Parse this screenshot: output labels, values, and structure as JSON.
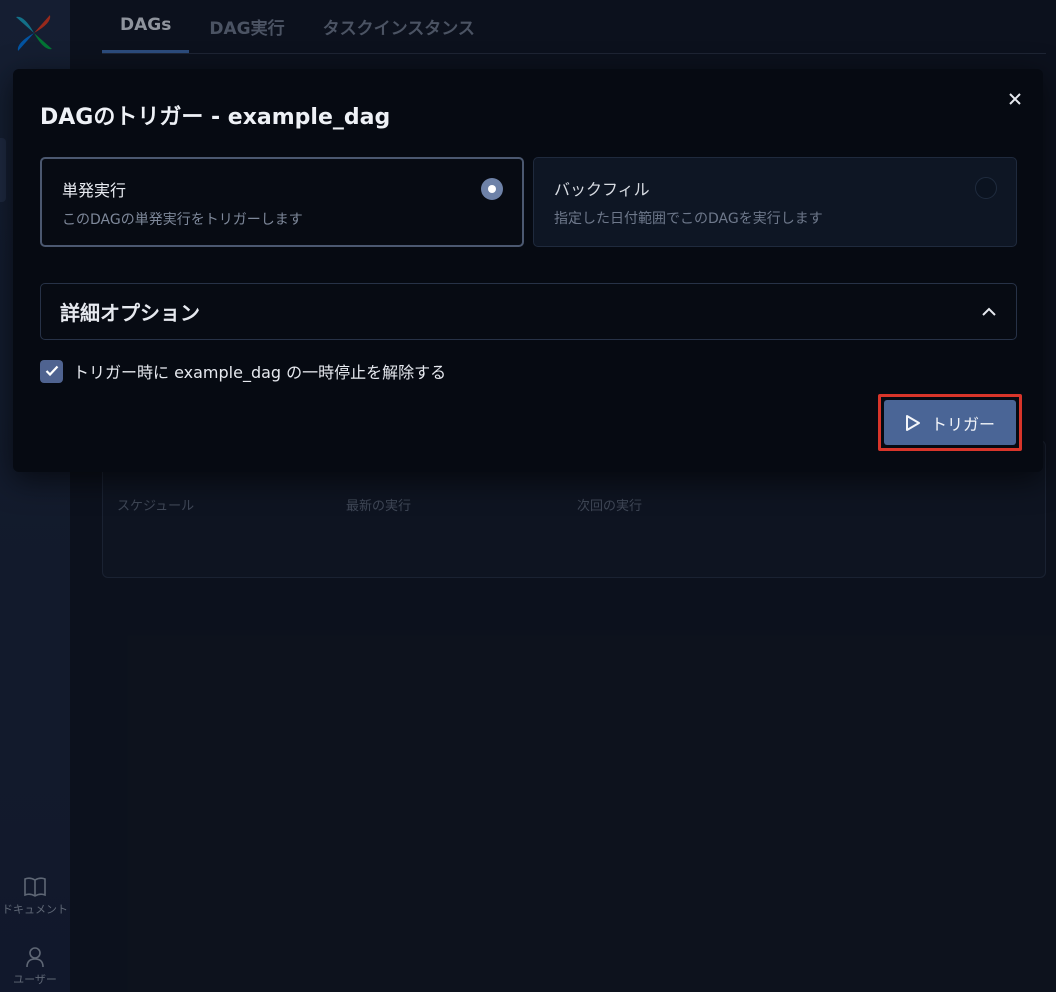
{
  "tabs": [
    {
      "label": "DAGs",
      "active": true
    },
    {
      "label": "DAG実行",
      "active": false
    },
    {
      "label": "タスクインスタンス",
      "active": false
    }
  ],
  "sidebar": {
    "docs_label": "ドキュメント",
    "user_label": "ユーザー"
  },
  "background_table": {
    "columns": [
      "スケジュール",
      "最新の実行",
      "次回の実行"
    ]
  },
  "modal": {
    "title": "DAGのトリガー - example_dag",
    "options": [
      {
        "title": "単発実行",
        "description": "このDAGの単発実行をトリガーします",
        "selected": true
      },
      {
        "title": "バックフィル",
        "description": "指定した日付範囲でこのDAGを実行します",
        "selected": false
      }
    ],
    "advanced_options_label": "詳細オプション",
    "unpause_label": "トリガー時に example_dag の一時停止を解除する",
    "unpause_checked": true,
    "trigger_button_label": "トリガー"
  },
  "colors": {
    "accent": "#4a6596",
    "highlight": "#d8352a",
    "background": "#0f1522",
    "modal_bg": "#060a12"
  }
}
